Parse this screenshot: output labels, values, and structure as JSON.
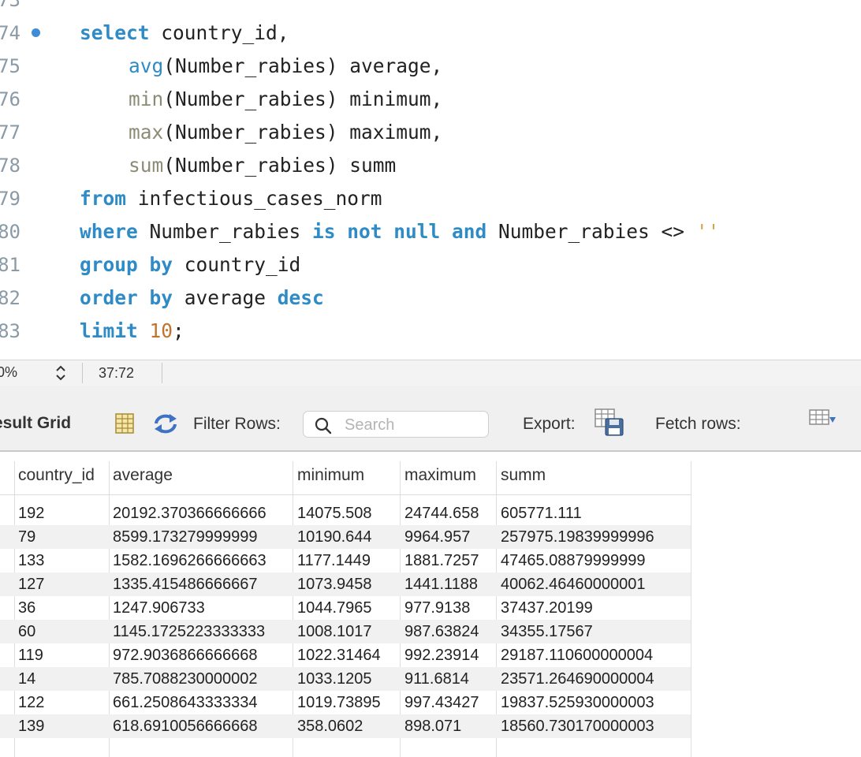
{
  "editor": {
    "first_line_fragment": "73",
    "lines": [
      {
        "num": "74",
        "dot": true
      },
      {
        "num": "75"
      },
      {
        "num": "76"
      },
      {
        "num": "77"
      },
      {
        "num": "78"
      },
      {
        "num": "79"
      },
      {
        "num": "80"
      },
      {
        "num": "81"
      },
      {
        "num": "82"
      },
      {
        "num": "83"
      }
    ],
    "tokens": {
      "l74": [
        "select",
        " country_id,"
      ],
      "l75": [
        "avg",
        "(Number_rabies) average,"
      ],
      "l76": [
        "min",
        "(Number_rabies) minimum,"
      ],
      "l77": [
        "max",
        "(Number_rabies) maximum,"
      ],
      "l78": [
        "sum",
        "(Number_rabies) summ"
      ],
      "l79": [
        "from",
        " infectious_cases_norm"
      ],
      "l80": [
        "where",
        " Number_rabies ",
        "is not null and",
        " Number_rabies <> ",
        "''"
      ],
      "l81": [
        "group by",
        " country_id"
      ],
      "l82": [
        "order by",
        " average ",
        "desc"
      ],
      "l83": [
        "limit",
        " ",
        "10",
        ";"
      ]
    }
  },
  "statusbar": {
    "zoom": "0%",
    "zoom_stepper": "⌃⌄",
    "cursor_position": "37:72"
  },
  "toolbar": {
    "title": "esult Grid",
    "filter_label": "Filter Rows:",
    "search_placeholder": "Search",
    "export_label": "Export:",
    "fetch_label": "Fetch rows:"
  },
  "icons": {
    "grid_toggle": "grid-icon",
    "refresh": "refresh-icon",
    "search": "search-icon",
    "export": "export-icon",
    "fetch": "fetch-rows-icon"
  },
  "colors": {
    "keyword": "#2e8bc6",
    "aggregate": "#8c8c76",
    "number": "#c0742e",
    "string": "#d6a24a",
    "line_dot": "#3f8cd6"
  },
  "table": {
    "columns": [
      "country_id",
      "average",
      "minimum",
      "maximum",
      "summ"
    ],
    "rows": [
      [
        "192",
        "20192.370366666666",
        "14075.508",
        "24744.658",
        "605771.111"
      ],
      [
        "79",
        "8599.173279999999",
        "10190.644",
        "9964.957",
        "257975.19839999996"
      ],
      [
        "133",
        "1582.1696266666663",
        "1177.1449",
        "1881.7257",
        "47465.08879999999"
      ],
      [
        "127",
        "1335.415486666667",
        "1073.9458",
        "1441.1188",
        "40062.46460000001"
      ],
      [
        "36",
        "1247.906733",
        "1044.7965",
        "977.9138",
        "37437.20199"
      ],
      [
        "60",
        "1145.1725223333333",
        "1008.1017",
        "987.63824",
        "34355.17567"
      ],
      [
        "119",
        "972.9036866666668",
        "1022.31464",
        "992.23914",
        "29187.110600000004"
      ],
      [
        "14",
        "785.7088230000002",
        "1033.1205",
        "911.6814",
        "23571.264690000004"
      ],
      [
        "122",
        "661.2508643333334",
        "1019.73895",
        "997.43427",
        "19837.525930000003"
      ],
      [
        "139",
        "618.6910056666668",
        "358.0602",
        "898.071",
        "18560.730170000003"
      ]
    ]
  }
}
